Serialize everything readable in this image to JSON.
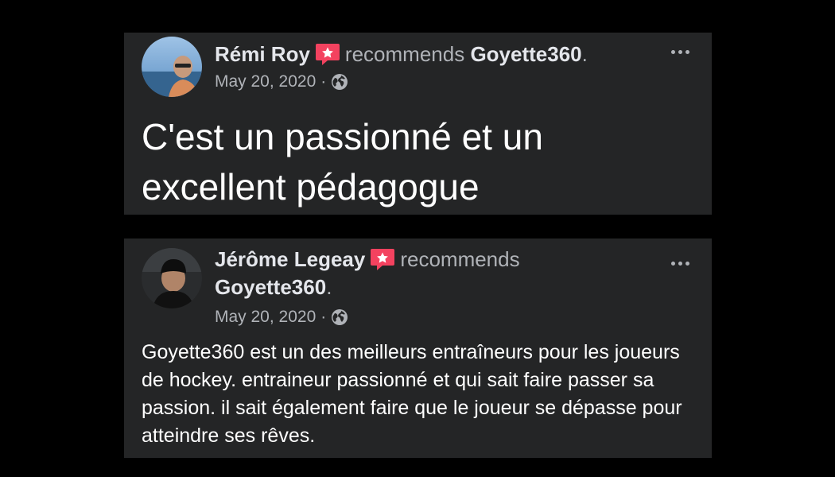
{
  "reviews": [
    {
      "reviewer": "Rémi Roy",
      "verb": "recommends",
      "page": "Goyette360",
      "date": "May 20, 2020",
      "separator": "·",
      "text": "C'est un passionné et un excellent pédagogue"
    },
    {
      "reviewer": "Jérôme Legeay",
      "verb": "recommends",
      "page": "Goyette360",
      "date": "May 20, 2020",
      "separator": "·",
      "text": "Goyette360 est un des meilleurs entraîneurs pour les joueurs de hockey. entraineur passionné et qui sait faire passer sa passion.  il sait également faire que le joueur se dépasse pour atteindre ses rêves."
    }
  ],
  "colors": {
    "background": "#000000",
    "card": "#242526",
    "recommend_badge": "#f3425f",
    "secondary_text": "#b0b3b8",
    "primary_text": "#ffffff"
  },
  "icons": {
    "recommend": "recommend-star-icon",
    "audience": "globe-icon",
    "more": "more-options-icon"
  }
}
